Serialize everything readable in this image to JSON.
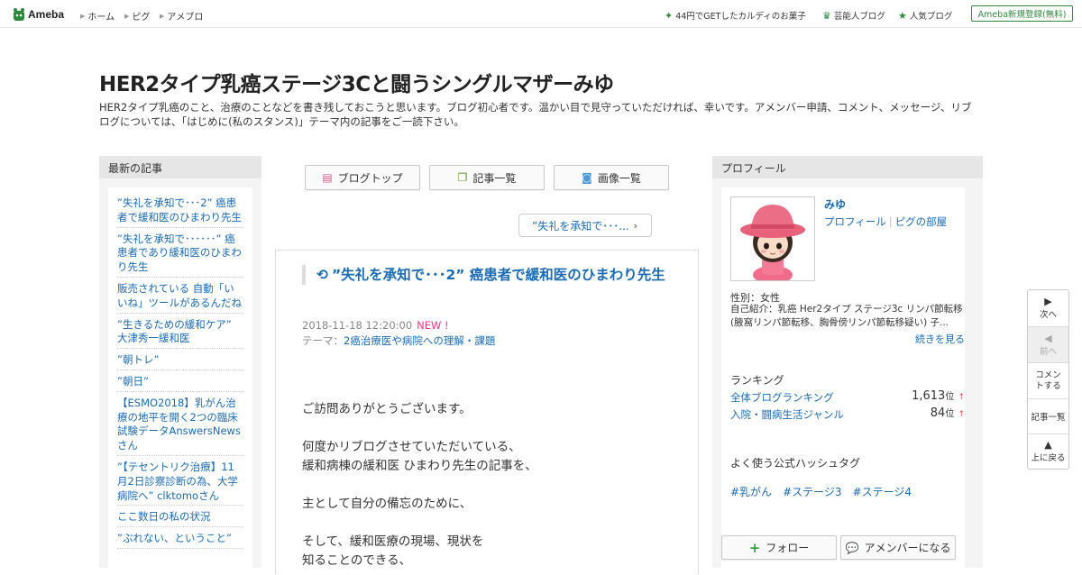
{
  "topbar": {
    "logo_text": "Ameba",
    "nav": [
      "ホーム",
      "ピグ",
      "アメブロ"
    ],
    "trends": [
      {
        "label": "44円でGETしたカルディのお菓子",
        "icon": "sparkle-icon"
      },
      {
        "label": "芸能人ブログ",
        "icon": "crown-icon"
      },
      {
        "label": "人気ブログ",
        "icon": "star-icon"
      }
    ],
    "signup_label": "Ameba新規登録(無料)"
  },
  "blog": {
    "title": "HER2タイプ乳癌ステージ3Cと闘うシングルマザーみゆ",
    "description": "HER2タイプ乳癌のこと、治療のことなどを書き残しておこうと思います。ブログ初心者です。温かい目で見守っていただければ、幸いです。アメンバー申請、コメント、メッセージ、リブログについては、「はじめに(私のスタンス)」テーマ内の記事をご一読下さい。"
  },
  "latest": {
    "heading": "最新の記事",
    "items": [
      "”失礼を承知で･･･2” 癌患者で緩和医のひまわり先生",
      "”失礼を承知で･･････” 癌患者であり緩和医のひまわり先生",
      "販売されている 自動「いいね」ツールがあるんだね",
      "”生きるための緩和ケア” 大津秀一緩和医",
      "”朝トレ”",
      "”朝日”",
      "【ESMO2018】乳がん治療の地平を開く2つの臨床試験データAnswersNewsさん",
      "”【テセントリク治療】11月2日診察診断の為、大学病院へ” clktomoさん",
      "ここ数日の私の状況",
      "”ぶれない、ということ”"
    ]
  },
  "tabs": {
    "blog_top": "ブログトップ",
    "entry_list": "記事一覧",
    "image_list": "画像一覧"
  },
  "prev_post_label": "”失礼を承知で･･･...",
  "article": {
    "title": "”失礼を承知で･･･2” 癌患者で緩和医のひまわり先生",
    "date": "2018-11-18 12:20:00",
    "new_badge": "NEW !",
    "theme_prefix": "テーマ：",
    "theme": "2癌治療医や病院への理解・課題",
    "body": [
      "ご訪問ありがとうございます。",
      "",
      "何度かリブログさせていただいている、",
      "緩和病棟の緩和医 ひまわり先生の記事を、",
      "",
      "主として自分の備忘のために、",
      "",
      "そして、緩和医療の現場、現状を",
      "知ることのできる、"
    ]
  },
  "profile": {
    "heading": "プロフィール",
    "name": "みゆ",
    "link_profile": "プロフィール",
    "link_pigg": "ピグの部屋",
    "gender": "性別：女性",
    "intro": "自己紹介：乳癌 Her2タイプ ステージ3c リンパ節転移 (腋窩リンパ節転移、胸骨傍リンパ節転移疑い) 子...",
    "more": "続きを見る",
    "ranking_heading": "ランキング",
    "rankings": [
      {
        "label": "全体ブログランキング",
        "value": "1,613",
        "unit": "位",
        "arrow": "↑"
      },
      {
        "label": "入院・闘病生活ジャンル",
        "value": "84",
        "unit": "位",
        "arrow": "↑"
      }
    ],
    "hashtag_heading": "よく使う公式ハッシュタグ",
    "hashtags": [
      "#乳がん",
      "#ステージ3",
      "#ステージ4"
    ],
    "follow_label": "フォロー",
    "amember_label": "アメンバーになる"
  },
  "float_nav": {
    "next": "次へ",
    "prev": "前へ",
    "comment": "コメントする",
    "entries": "記事一覧",
    "top": "上に戻る"
  },
  "colors": {
    "link": "#1a6bb5",
    "ameba_green": "#2d8a3c",
    "new_pink": "#e8388a",
    "sidebar_bg": "#f4f4f4",
    "header_bg": "#e6e6e6"
  }
}
